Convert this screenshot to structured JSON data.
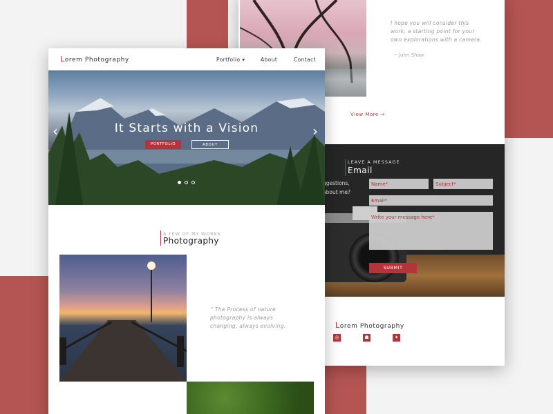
{
  "colors": {
    "accent": "#b3353a",
    "deco": "#b55553",
    "dark": "#262626"
  },
  "back_page": {
    "quote": "I hope you will consider this work, a starting point for your own explorations with a camera.",
    "quote_author": "~ John Shaw",
    "view_more": "View More →",
    "contact": {
      "pretitle": "LEAVE A MESSAGE",
      "title": "Email",
      "side_text": "ggestions, about me?",
      "name_placeholder": "Name*",
      "subject_placeholder": "Subject*",
      "email_placeholder": "Email*",
      "message_placeholder": "Write your message here*",
      "submit": "SUBMIT"
    },
    "footer": {
      "brand_first": "L",
      "brand_rest": "orem Photography"
    },
    "social_icons": [
      "instagram-icon",
      "snapchat-icon",
      "twitter-icon"
    ]
  },
  "front_page": {
    "nav": {
      "brand_first": "L",
      "brand_rest": "orem Photography",
      "links": [
        "Portfolio ▾",
        "About",
        "Contact"
      ]
    },
    "hero": {
      "title": "It Starts with a Vision",
      "btn_portfolio": "PORTFOLIO",
      "btn_about": "ABOUT",
      "prev": "‹",
      "next": "›",
      "slides": 3,
      "active_slide": 1
    },
    "section": {
      "pretitle": "A FEW OF MY WORKS",
      "title": "Photography"
    },
    "quote": "“ The Process of nature photography is always changing, always evolving."
  }
}
